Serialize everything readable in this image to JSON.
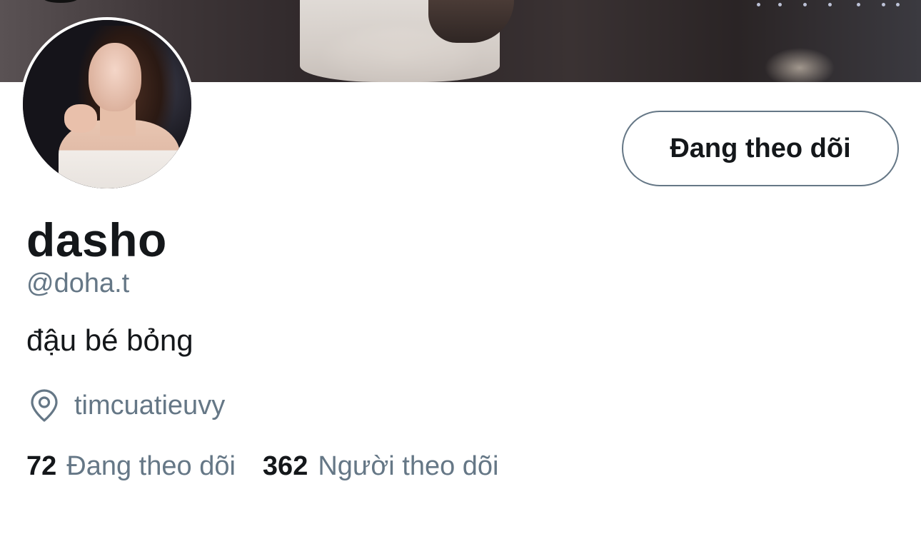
{
  "profile": {
    "display_name": "dasho",
    "handle": "@doha.t",
    "bio": "đậu bé bỏng",
    "location": "timcuatieuvy",
    "location_icon": "map-pin-icon"
  },
  "actions": {
    "follow_button_label": "Đang theo dõi"
  },
  "stats": {
    "following_count": "72",
    "following_label": "Đang theo dõi",
    "followers_count": "362",
    "followers_label": "Người theo dõi"
  },
  "colors": {
    "text_primary": "#14171a",
    "text_secondary": "#657786",
    "button_border": "#657786",
    "background": "#ffffff"
  }
}
